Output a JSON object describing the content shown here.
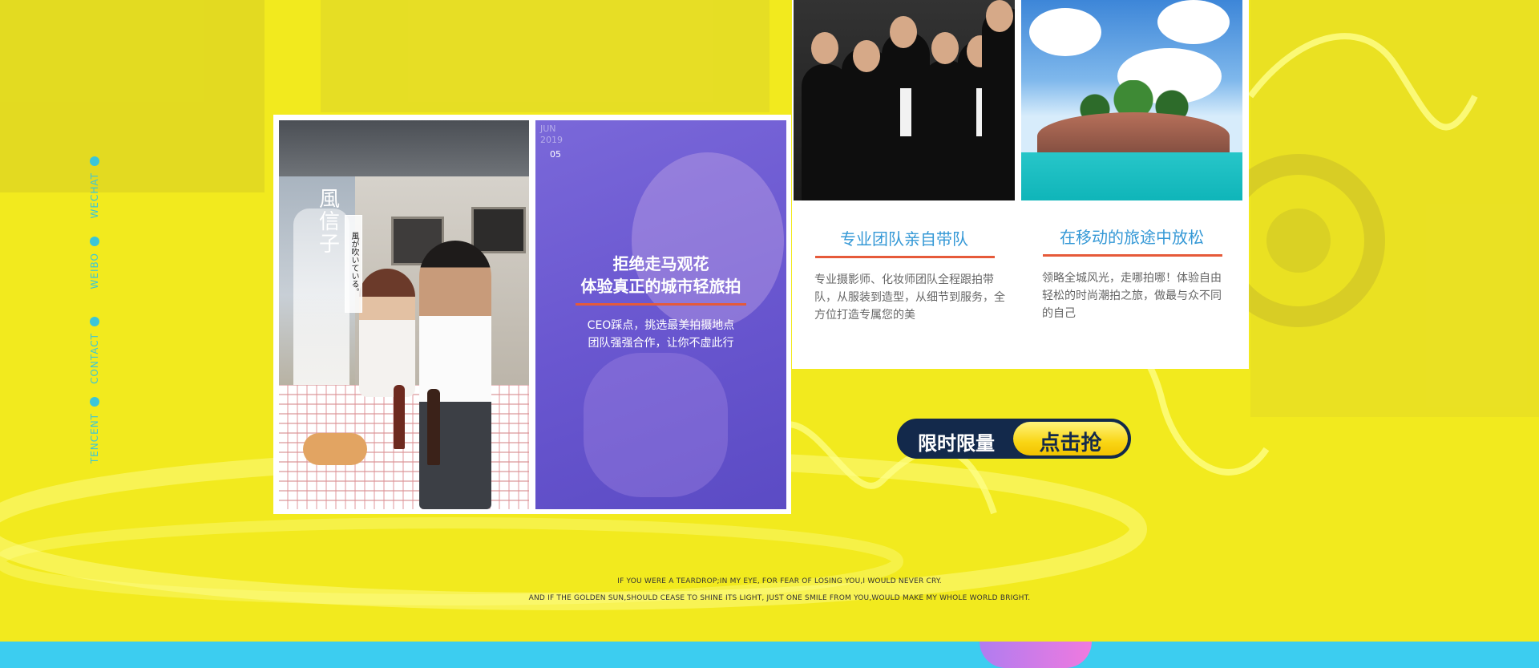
{
  "side_nav": {
    "items": [
      {
        "label": "WECHAT"
      },
      {
        "label": "WEIBO"
      },
      {
        "label": "CONTACT"
      },
      {
        "label": "TENCENT"
      }
    ]
  },
  "photo_left": {
    "poem_title": "風信子",
    "poem_vertical": "風が吹いている。"
  },
  "photo_right": {
    "date_month": "JUN",
    "date_year": "2019",
    "date_day": "05",
    "title_line1": "拒绝走马观花",
    "title_line2": "体验真正的城市轻旅拍",
    "desc_line1": "CEO踩点，挑选最美拍摄地点",
    "desc_line2": "团队强强合作，让你不虚此行"
  },
  "cards": [
    {
      "title": "专业团队亲自带队",
      "desc": "专业摄影师、化妆师团队全程跟拍带队，从服装到造型，从细节到服务，全方位打造专属您的美"
    },
    {
      "title": "在移动的旅途中放松",
      "desc": "领略全城风光，走哪拍哪！体验自由轻松的时尚潮拍之旅，做最与众不同的自己"
    }
  ],
  "cta": {
    "left_label": "限时限量",
    "button_label": "点击抢"
  },
  "quotes": {
    "line1": "IF YOU WERE A TEARDROP;IN MY EYE,  FOR FEAR OF LOSING YOU,I WOULD NEVER CRY.",
    "line2": "AND IF THE GOLDEN SUN,SHOULD CEASE TO SHINE ITS LIGHT,  JUST ONE SMILE FROM YOU,WOULD MAKE MY WHOLE WORLD BRIGHT."
  },
  "colors": {
    "background": "#f2ea1e",
    "accent_cyan": "#3ac6d9",
    "card_title": "#3498d6",
    "underline": "#e65a3a",
    "cta_navy": "#13294b",
    "cta_yellow": "#f9d615"
  }
}
